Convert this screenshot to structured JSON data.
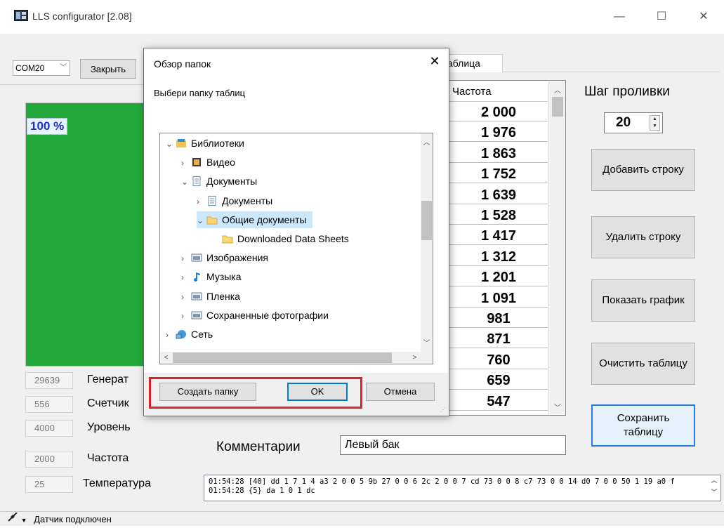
{
  "window": {
    "title": "LLS configurator [2.08]",
    "minimize": "—",
    "maximize": "☐",
    "close": "✕"
  },
  "toolbar": {
    "port": "COM20",
    "close_label": "Закрыть"
  },
  "gauge": {
    "level_percent": 100,
    "label": "100 %",
    "fill_color": "#22a83a",
    "label_color": "#1f2bd6"
  },
  "readouts": [
    {
      "value": "29639",
      "label": "Генерат"
    },
    {
      "value": "556",
      "label": "Счетчик"
    },
    {
      "value": "4000",
      "label": "Уровень"
    },
    {
      "value": "2000",
      "label": "Частота"
    },
    {
      "value": "25",
      "label": "Температура"
    }
  ],
  "tab": {
    "label": "аблица"
  },
  "table": {
    "column_header": "Частота",
    "values": [
      "2 000",
      "1 976",
      "1 863",
      "1 752",
      "1 639",
      "1 528",
      "1 417",
      "1 312",
      "1 201",
      "1 091",
      "981",
      "871",
      "760",
      "659",
      "547"
    ]
  },
  "right_panel": {
    "step_label": "Шаг проливки",
    "step_value": "20",
    "add_row": "Добавить строку",
    "delete_row": "Удалить строку",
    "show_chart": "Показать график",
    "clear_table": "Очистить таблицу",
    "save_table": "Сохранить таблицу"
  },
  "comment": {
    "label": "Комментарии",
    "value": "Левый бак"
  },
  "log": {
    "lines": [
      "01:54:28 [40]  dd 1 7 1 4 a3 2 0 0 5 9b 27 0 0 6 2c 2 0 0 7 cd 73 0 0 8 c7 73 0 0 14 d0 7 0 0 50 1 19 a0 f",
      "01:54:28 {5}  da 1 0 1 dc"
    ]
  },
  "status": {
    "text": "Датчик подключен"
  },
  "dialog": {
    "title": "Обзор папок",
    "close": "✕",
    "description": "Выбери папку таблиц",
    "tree": [
      {
        "label": "Библиотеки",
        "level": 0,
        "expanded": true,
        "icon": "library-icon"
      },
      {
        "label": "Видео",
        "level": 1,
        "expanded": false,
        "icon": "video-icon"
      },
      {
        "label": "Документы",
        "level": 1,
        "expanded": true,
        "icon": "documents-icon"
      },
      {
        "label": "Документы",
        "level": 2,
        "expanded": false,
        "icon": "documents-icon"
      },
      {
        "label": "Общие документы",
        "level": 2,
        "expanded": true,
        "icon": "folder-icon",
        "selected": true
      },
      {
        "label": "Downloaded Data Sheets",
        "level": 3,
        "expanded": null,
        "icon": "folder-icon"
      },
      {
        "label": "Изображения",
        "level": 1,
        "expanded": false,
        "icon": "pictures-icon"
      },
      {
        "label": "Музыка",
        "level": 1,
        "expanded": false,
        "icon": "music-icon"
      },
      {
        "label": "Пленка",
        "level": 1,
        "expanded": false,
        "icon": "pictures-icon"
      },
      {
        "label": "Сохраненные фотографии",
        "level": 1,
        "expanded": false,
        "icon": "pictures-icon"
      },
      {
        "label": "Сеть",
        "level": 0,
        "expanded": false,
        "icon": "network-icon"
      }
    ],
    "new_folder": "Создать папку",
    "ok": "OK",
    "cancel": "Отмена"
  },
  "colors": {
    "highlight_box": "#e0202a",
    "selection": "#cce8ff",
    "focus_border": "#0078d7"
  }
}
